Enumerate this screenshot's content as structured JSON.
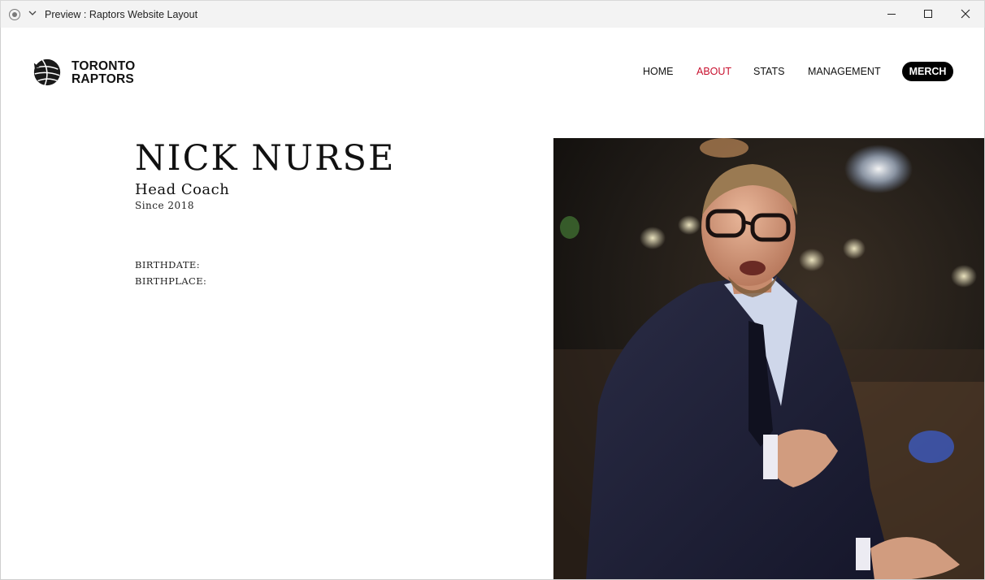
{
  "window": {
    "title": "Preview : Raptors Website Layout"
  },
  "brand": {
    "line1": "TORONTO",
    "line2": "RAPTORS",
    "accent": "#c8102e"
  },
  "nav": {
    "home": "HOME",
    "about": "ABOUT",
    "stats": "STATS",
    "management": "MANAGEMENT",
    "merch": "MERCH",
    "active": "ABOUT"
  },
  "profile": {
    "name": "NICK NURSE",
    "role": "Head Coach",
    "since": "Since 2018",
    "birthdate_label": "BIRTHDATE:",
    "birthplace_label": "BIRTHPLACE:"
  },
  "icons": {
    "record": "record-icon",
    "chevron": "chevron-down-icon",
    "minimize": "minimize-icon",
    "maximize": "maximize-icon",
    "close": "close-icon",
    "logo": "basketball-claw-icon"
  }
}
